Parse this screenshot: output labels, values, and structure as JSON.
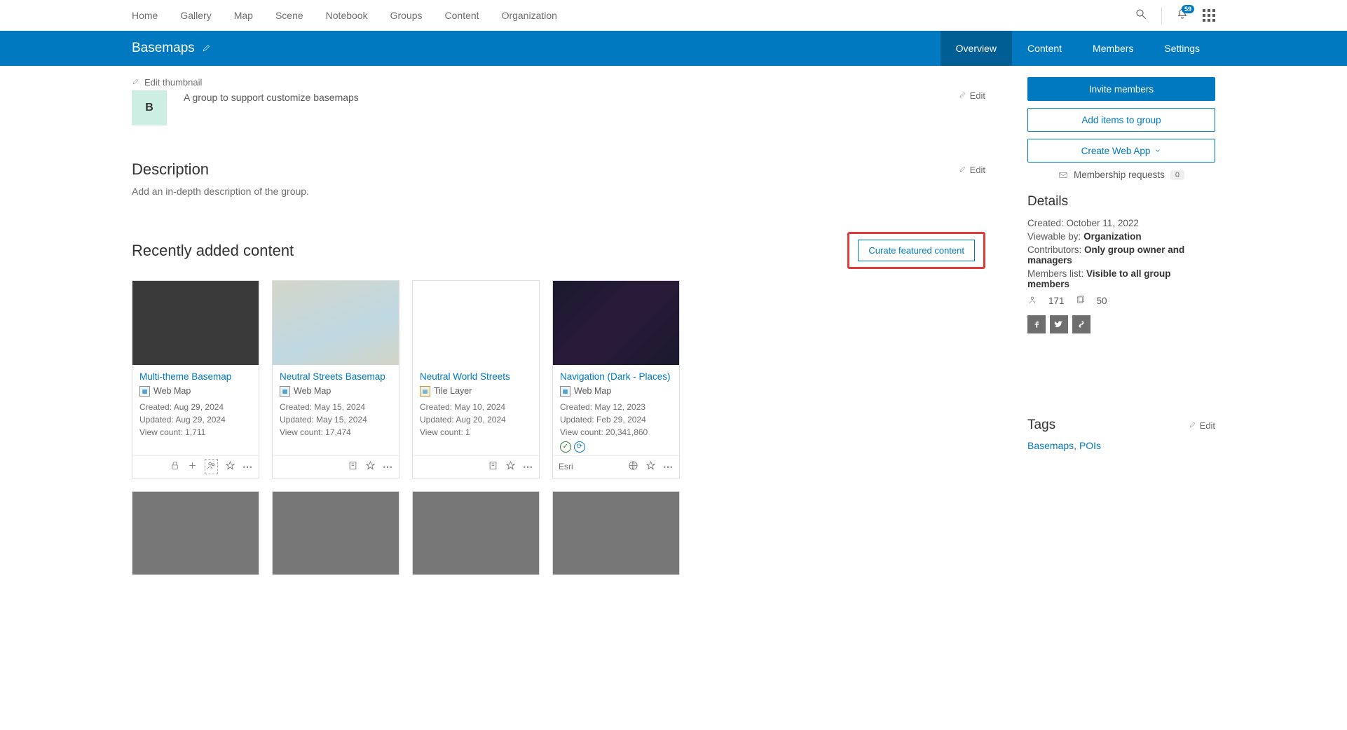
{
  "topnav": {
    "items": [
      "Home",
      "Gallery",
      "Map",
      "Scene",
      "Notebook",
      "Groups",
      "Content",
      "Organization"
    ],
    "notif_count": "59"
  },
  "groupbar": {
    "title": "Basemaps",
    "tabs": [
      "Overview",
      "Content",
      "Members",
      "Settings"
    ],
    "active_index": 0
  },
  "header": {
    "edit_thumb": "Edit thumbnail",
    "thumb_letter": "B",
    "summary": "A group to support customize basemaps",
    "edit_label": "Edit"
  },
  "description": {
    "title": "Description",
    "placeholder": "Add an in-depth description of the group.",
    "edit_label": "Edit"
  },
  "recent": {
    "title": "Recently added content",
    "curate_label": "Curate featured content",
    "cards": [
      {
        "title": "Multi-theme Basemap",
        "type": "Web Map",
        "type_kind": "map",
        "thumb": "t-dark",
        "created": "Created: Aug 29, 2024",
        "updated": "Updated: Aug 29, 2024",
        "views": "View count: 1,711",
        "footer": {
          "owner": null,
          "icons": [
            "lock",
            "plus",
            "group",
            "star",
            "dots"
          ]
        }
      },
      {
        "title": "Neutral Streets Basemap",
        "type": "Web Map",
        "type_kind": "map",
        "thumb": "t-light",
        "created": "Created: May 15, 2024",
        "updated": "Updated: May 15, 2024",
        "views": "View count: 17,474",
        "footer": {
          "owner": null,
          "icons": [
            "org",
            "star",
            "dots"
          ]
        }
      },
      {
        "title": "Neutral World Streets",
        "type": "Tile Layer",
        "type_kind": "tile",
        "thumb": "t-blank",
        "created": "Created: May 10, 2024",
        "updated": "Updated: Aug 20, 2024",
        "views": "View count: 1",
        "footer": {
          "owner": null,
          "icons": [
            "org",
            "star",
            "dots"
          ]
        }
      },
      {
        "title": "Navigation (Dark - Places)",
        "type": "Web Map",
        "type_kind": "map",
        "thumb": "t-navdark",
        "created": "Created: May 12, 2023",
        "updated": "Updated: Feb 29, 2024",
        "views": "View count: 20,341,860",
        "badges": [
          "green",
          "blue"
        ],
        "footer": {
          "owner": "Esri",
          "icons": [
            "globe",
            "star",
            "dots"
          ]
        }
      }
    ],
    "row2_thumbs": [
      "t-street",
      "t-terrain1",
      "t-terrain2",
      "t-enhanced"
    ]
  },
  "sidebar": {
    "invite_label": "Invite members",
    "add_items_label": "Add items to group",
    "create_app_label": "Create Web App",
    "membership_requests_label": "Membership requests",
    "membership_requests_count": "0",
    "details": {
      "title": "Details",
      "created_label": "Created: ",
      "created_val": "October 11, 2022",
      "viewable_label": "Viewable by: ",
      "viewable_val": "Organization",
      "contrib_label": "Contributors: ",
      "contrib_val": "Only group owner and managers",
      "members_label": "Members list: ",
      "members_val": "Visible to all group members",
      "member_count": "171",
      "item_count": "50"
    },
    "tags": {
      "title": "Tags",
      "edit_label": "Edit",
      "items": [
        "Basemaps",
        "POIs"
      ]
    }
  }
}
